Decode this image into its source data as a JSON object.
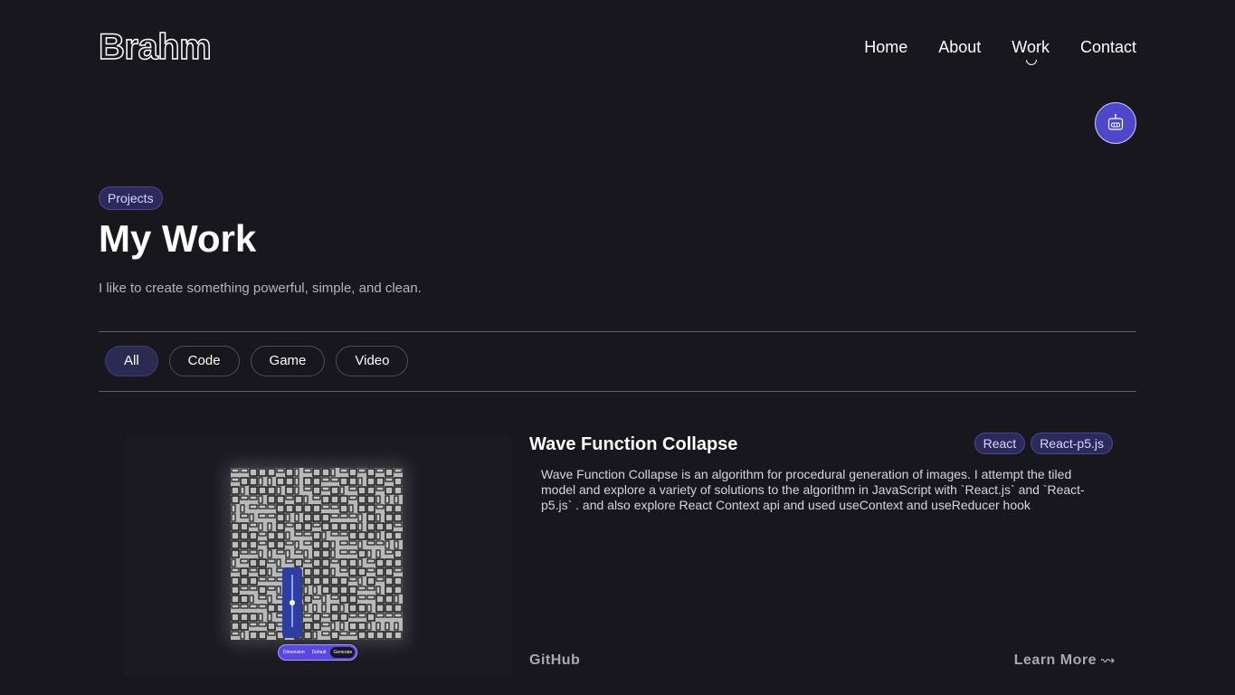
{
  "header": {
    "logo": "Brahm",
    "nav": [
      "Home",
      "About",
      "Work",
      "Contact"
    ],
    "active_nav": "Work"
  },
  "assistant_button": {
    "icon": "robot-icon"
  },
  "hero": {
    "badge": "Projects",
    "title": "My Work",
    "subtitle": "I like to create something powerful, simple, and clean."
  },
  "filters": {
    "items": [
      "All",
      "Code",
      "Game",
      "Video"
    ],
    "active": "All"
  },
  "project": {
    "title": "Wave Function Collapse",
    "tags": [
      "React",
      "React-p5.js"
    ],
    "description": "Wave Function Collapse is an algorithm for procedural generation of images. I attempt the tiled model and explore a variety of solutions to the algorithm in JavaScript with `React.js` and `React-p5.js` . and also explore React Context api and used useContext and useReducer hook",
    "github_label": "GitHub",
    "learn_more_label": "Learn More",
    "preview_controls": [
      "Dimension",
      "Default",
      "Generate"
    ]
  },
  "colors": {
    "background": "#18171d",
    "accent": "#4f47c9",
    "badge_bg": "#2b2a5c"
  }
}
